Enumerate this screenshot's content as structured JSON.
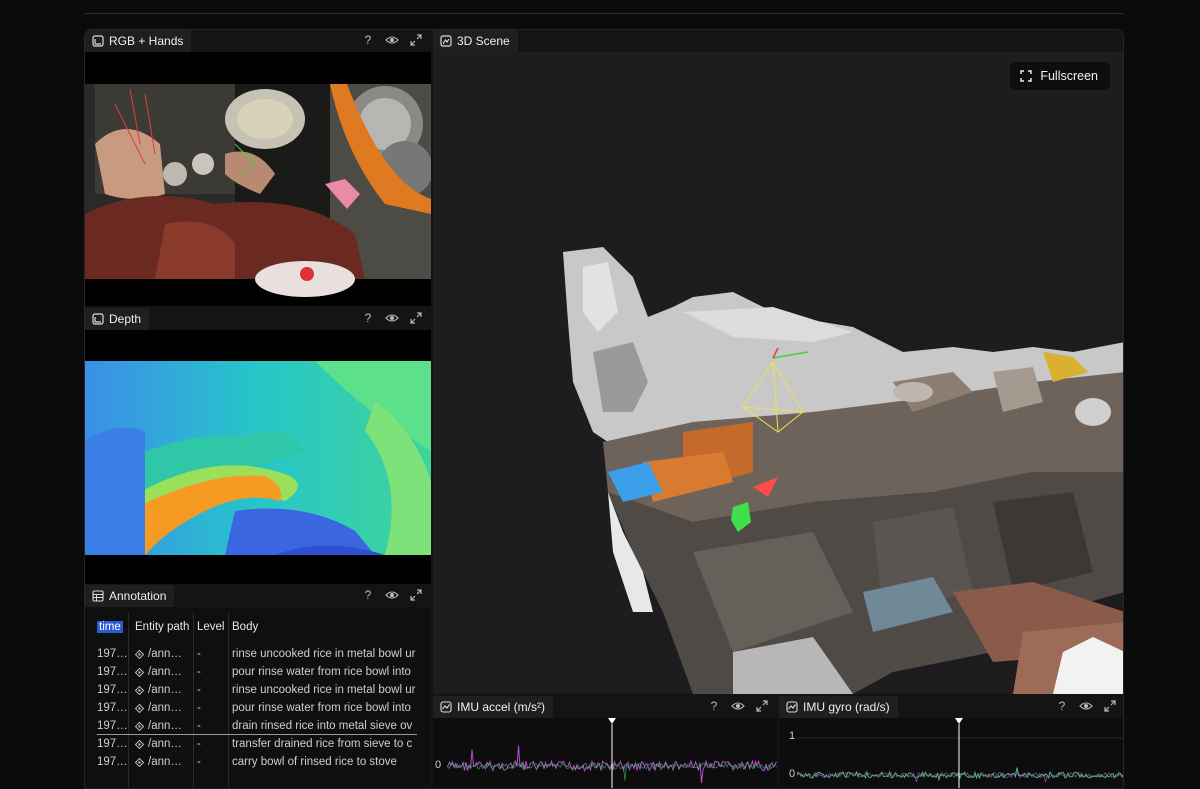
{
  "panels": {
    "rgb": {
      "title": "RGB + Hands"
    },
    "depth": {
      "title": "Depth"
    },
    "scene": {
      "title": "3D Scene",
      "fullscreen_label": "Fullscreen"
    },
    "annotation": {
      "title": "Annotation",
      "columns": [
        "time",
        "Entity path",
        "Level",
        "Body"
      ],
      "rows": [
        {
          "time": "197…",
          "path": "/ann…",
          "level": "-",
          "body": "rinse uncooked rice in metal bowl ur"
        },
        {
          "time": "197…",
          "path": "/ann…",
          "level": "-",
          "body": "pour rinse water from rice bowl into"
        },
        {
          "time": "197…",
          "path": "/ann…",
          "level": "-",
          "body": "rinse uncooked rice in metal bowl ur"
        },
        {
          "time": "197…",
          "path": "/ann…",
          "level": "-",
          "body": "pour rinse water from rice bowl into"
        },
        {
          "time": "197…",
          "path": "/ann…",
          "level": "-",
          "body": "drain rinsed rice into metal sieve ov"
        },
        {
          "time": "197…",
          "path": "/ann…",
          "level": "-",
          "body": "transfer drained rice from sieve to c"
        },
        {
          "time": "197…",
          "path": "/ann…",
          "level": "-",
          "body": "carry bowl of rinsed rice to stove"
        }
      ]
    },
    "imu_accel": {
      "title": "IMU accel (m/s²)",
      "tick_0": "0"
    },
    "imu_gyro": {
      "title": "IMU gyro (rad/s)",
      "tick_1": "1",
      "tick_0": "0"
    }
  },
  "tool_icons": [
    "help-icon",
    "eye-icon",
    "maximize-icon"
  ],
  "colors": {
    "accent": "#2a5bd7",
    "panel_bg": "#141415",
    "tab_bg": "#1f1f21",
    "accel_series": "#b44fc8",
    "gyro_series": "#3ac46a"
  }
}
